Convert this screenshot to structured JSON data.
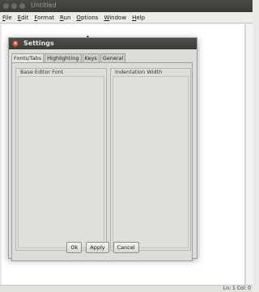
{
  "app": {
    "title": "Untitled"
  },
  "menu": {
    "items": [
      {
        "label": "File",
        "mnemonic": "F",
        "rest": "ile"
      },
      {
        "label": "Edit",
        "mnemonic": "E",
        "rest": "dit"
      },
      {
        "label": "Format",
        "mnemonic": "F",
        "rest": "ormat"
      },
      {
        "label": "Run",
        "mnemonic": "R",
        "rest": "un"
      },
      {
        "label": "Options",
        "mnemonic": "O",
        "rest": "ptions"
      },
      {
        "label": "Window",
        "mnemonic": "W",
        "rest": "indow"
      },
      {
        "label": "Help",
        "mnemonic": "H",
        "rest": "elp"
      }
    ]
  },
  "status": {
    "position": "Ln: 1 Col: 0"
  },
  "dialog": {
    "title": "Settings",
    "close_glyph": "×",
    "tabs": [
      "Fonts/Tabs",
      "Highlighting",
      "Keys",
      "General"
    ],
    "active_tab": "Fonts/Tabs",
    "base_font_label": "Base Editor Font",
    "indent_label": "Indentation Width",
    "buttons": {
      "ok": "Ok",
      "apply": "Apply",
      "cancel": "Cancel"
    }
  },
  "icons": {
    "cursor": "mouse-cursor-icon"
  }
}
